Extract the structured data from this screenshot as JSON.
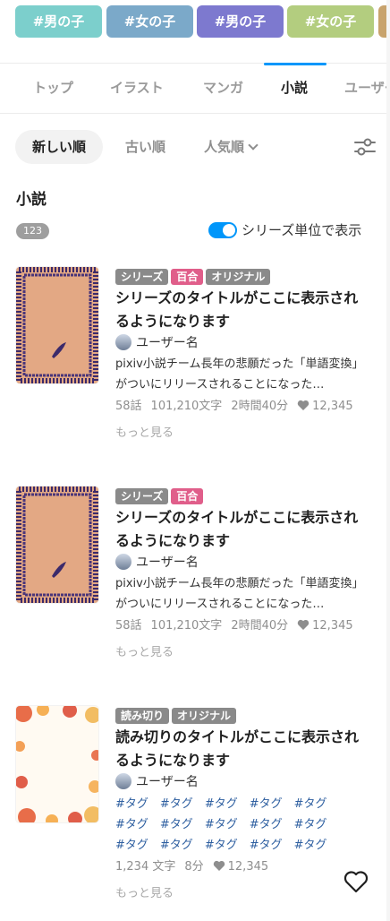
{
  "tags": [
    {
      "label": "#男の子",
      "color": "#7ccfcc"
    },
    {
      "label": "#女の子",
      "color": "#7ba9c9"
    },
    {
      "label": "#男の子",
      "color": "#7d79cf"
    },
    {
      "label": "#女の子",
      "color": "#b3cd7f"
    },
    {
      "label": "",
      "color": "#c8a36d"
    }
  ],
  "tabs": [
    "トップ",
    "イラスト",
    "マンガ",
    "小説",
    "ユーザー"
  ],
  "active_tab": "小説",
  "sort": {
    "newest": "新しい順",
    "oldest": "古い順",
    "popular": "人気順"
  },
  "section": {
    "title": "小説",
    "count": "123",
    "series_toggle_label": "シリーズ単位で表示",
    "series_toggle_on": true
  },
  "novels": [
    {
      "badges": [
        "シリーズ",
        "百合",
        "オリジナル"
      ],
      "title": "シリーズのタイトルがここに表示されるようになります",
      "author": "ユーザー名",
      "caption": "pixiv小説チーム長年の悲願だった「単語変換」がついにリリースされることになった…",
      "episodes": "58話",
      "chars": "101,210文字",
      "time": "2時間40分",
      "likes": "12,345",
      "more": "もっと見る"
    },
    {
      "badges": [
        "シリーズ",
        "百合"
      ],
      "title": "シリーズのタイトルがここに表示されるようになります",
      "author": "ユーザー名",
      "caption": "pixiv小説チーム長年の悲願だった「単語変換」がついにリリースされることになった…",
      "episodes": "58話",
      "chars": "101,210文字",
      "time": "2時間40分",
      "likes": "12,345",
      "more": "もっと見る"
    },
    {
      "badges": [
        "読み切り",
        "オリジナル"
      ],
      "title": "読み切りのタイトルがここに表示されるようになります",
      "author": "ユーザー名",
      "tags": [
        "#タグ",
        "#タグ",
        "#タグ",
        "#タグ",
        "#タグ",
        "#タグ",
        "#タグ",
        "#タグ",
        "#タグ",
        "#タグ",
        "#タグ",
        "#タグ",
        "#タグ",
        "#タグ",
        "#タグ"
      ],
      "chars": "1,234 文字",
      "time": "8分",
      "likes": "12,345",
      "more": "もっと見る"
    }
  ],
  "colors": {
    "accent": "#0096fa",
    "pink_badge": "#e05e8a",
    "gray_badge": "#8a8a8a",
    "tag_link": "#2e5fa0"
  },
  "icons": [
    "filter-icon",
    "chevron-down-icon",
    "heart-icon",
    "favorite-heart-icon"
  ]
}
